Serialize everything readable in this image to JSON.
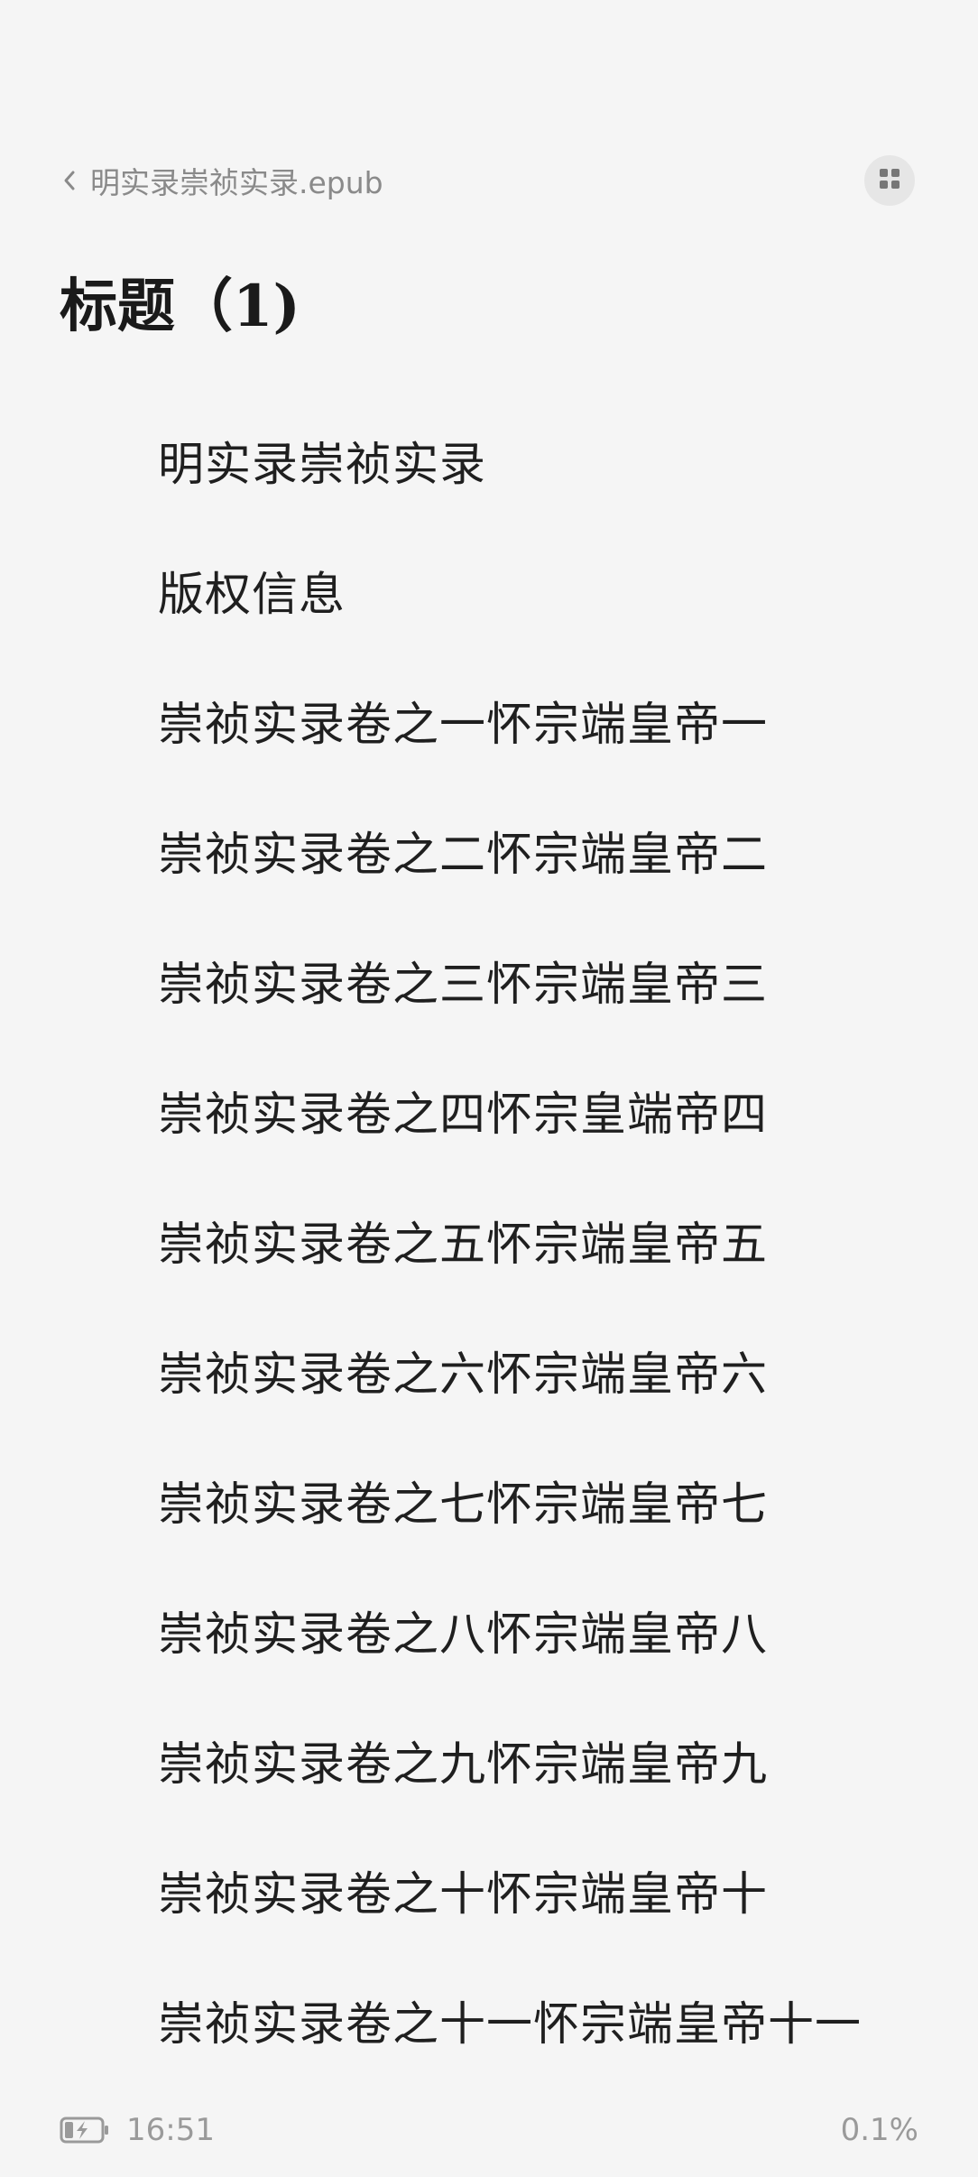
{
  "header": {
    "back_icon": "chevron-left-icon",
    "book_title": "明实录崇祯实录.epub",
    "grid_icon": "grid-icon"
  },
  "heading": {
    "text": "标题（1)"
  },
  "toc": {
    "items": [
      {
        "label": "明实录崇祯实录"
      },
      {
        "label": "版权信息"
      },
      {
        "label": "崇祯实录卷之一怀宗端皇帝一"
      },
      {
        "label": "崇祯实录卷之二怀宗端皇帝二"
      },
      {
        "label": "崇祯实录卷之三怀宗端皇帝三"
      },
      {
        "label": "崇祯实录卷之四怀宗皇端帝四"
      },
      {
        "label": "崇祯实录卷之五怀宗端皇帝五"
      },
      {
        "label": "崇祯实录卷之六怀宗端皇帝六"
      },
      {
        "label": "崇祯实录卷之七怀宗端皇帝七"
      },
      {
        "label": "崇祯实录卷之八怀宗端皇帝八"
      },
      {
        "label": "崇祯实录卷之九怀宗端皇帝九"
      },
      {
        "label": "崇祯实录卷之十怀宗端皇帝十"
      },
      {
        "label": "崇祯实录卷之十一怀宗端皇帝十一"
      }
    ]
  },
  "footer": {
    "battery_icon": "battery-charging-icon",
    "time": "16:51",
    "progress": "0.1%"
  },
  "colors": {
    "background": "#f5f5f5",
    "text_primary": "#1f1f1f",
    "text_secondary": "#8a8a8a",
    "button_bg": "#e6e6e6"
  }
}
